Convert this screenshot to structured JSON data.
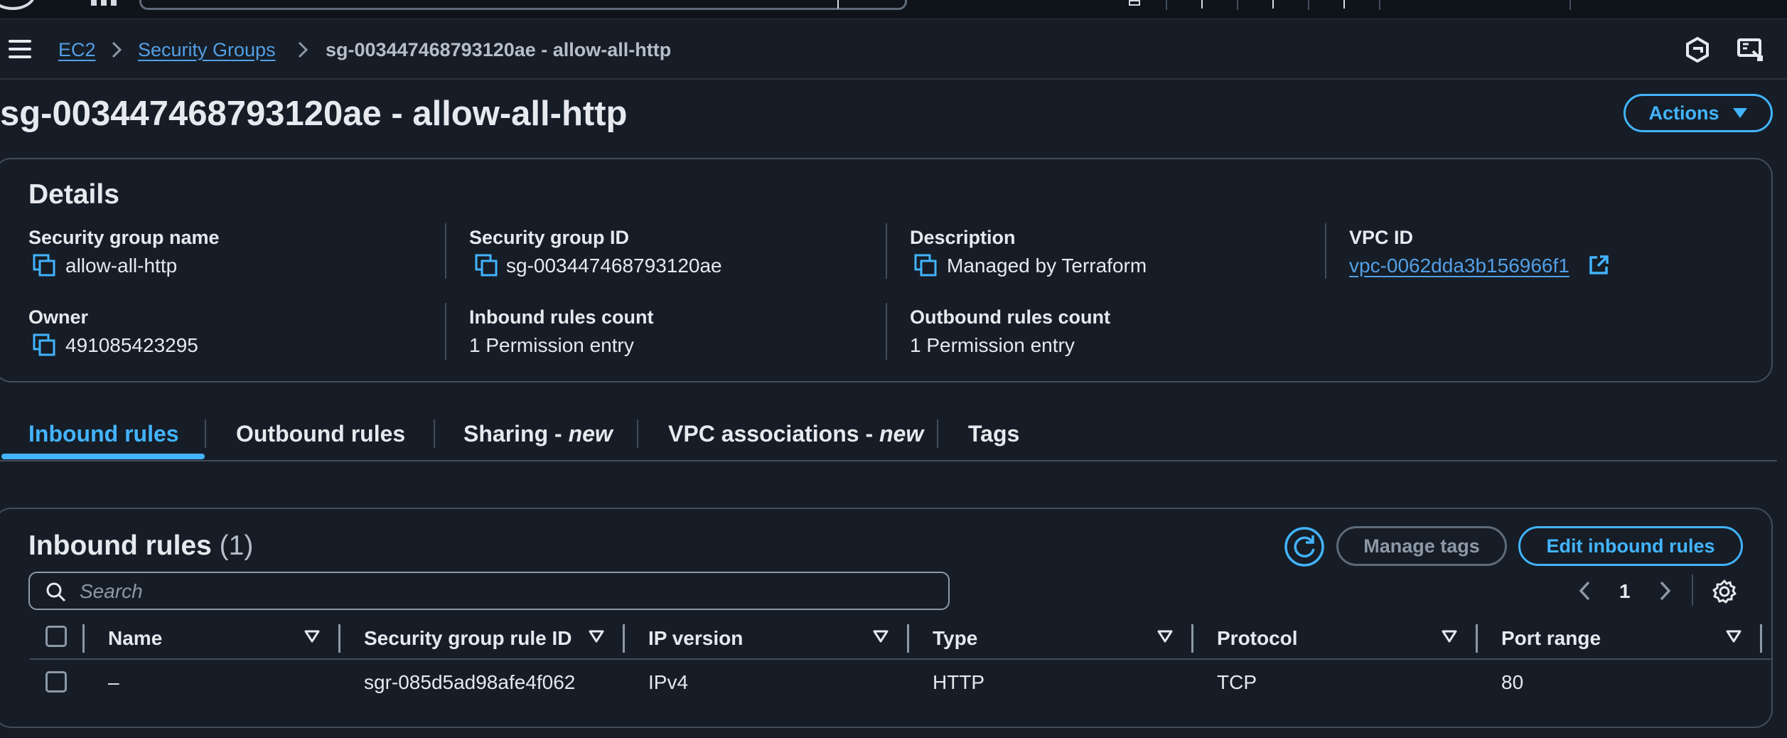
{
  "breadcrumb": {
    "items": [
      "EC2",
      "Security Groups"
    ],
    "current": "sg-003447468793120ae - allow-all-http"
  },
  "page": {
    "title": "sg-003447468793120ae - allow-all-http",
    "actions_label": "Actions"
  },
  "details": {
    "title": "Details",
    "fields": [
      {
        "label": "Security group name",
        "value": "allow-all-http"
      },
      {
        "label": "Security group ID",
        "value": "sg-003447468793120ae"
      },
      {
        "label": "Description",
        "value": "Managed by Terraform"
      },
      {
        "label": "VPC ID",
        "value": "vpc-0062dda3b156966f1"
      },
      {
        "label": "Owner",
        "value": "491085423295"
      },
      {
        "label": "Inbound rules count",
        "value": "1 Permission entry"
      },
      {
        "label": "Outbound rules count",
        "value": "1 Permission entry"
      }
    ]
  },
  "tabs": [
    {
      "label": "Inbound rules"
    },
    {
      "label": "Outbound rules"
    },
    {
      "label": "Sharing - ",
      "tag": "new"
    },
    {
      "label": "VPC associations - ",
      "tag": "new"
    },
    {
      "label": "Tags"
    }
  ],
  "rules": {
    "title": "Inbound rules",
    "count": "(1)",
    "manage_tags_label": "Manage tags",
    "edit_label": "Edit inbound rules",
    "search_placeholder": "Search",
    "page_number": "1",
    "columns": [
      "Name",
      "Security group rule ID",
      "IP version",
      "Type",
      "Protocol",
      "Port range"
    ],
    "rows": [
      [
        "–",
        "sgr-085d5ad98afe4f062",
        "IPv4",
        "HTTP",
        "TCP",
        "80"
      ]
    ]
  },
  "colors": {
    "background": "#161d26",
    "accent": "#42b4ff",
    "link": "#539fe5",
    "border": "#414d5c"
  }
}
